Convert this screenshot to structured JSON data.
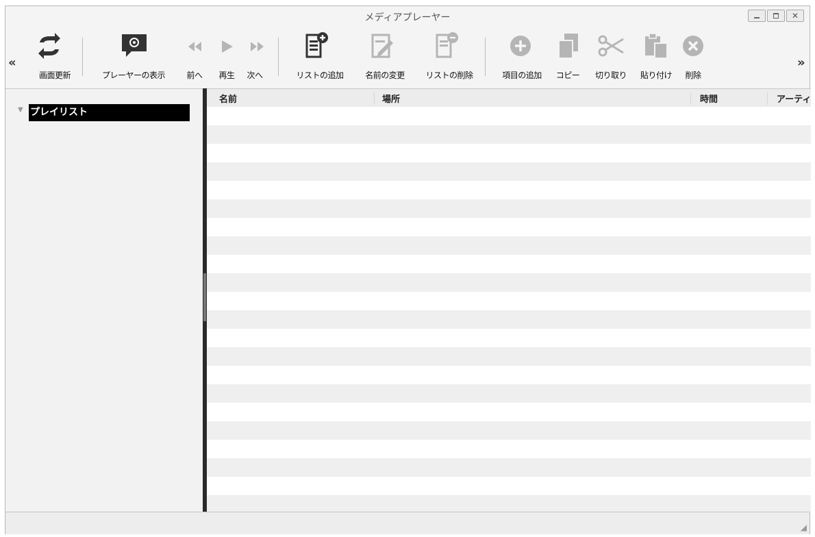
{
  "window": {
    "title": "メディアプレーヤー",
    "controls": {
      "minimize_icon": "minimize-icon",
      "maximize_icon": "maximize-icon",
      "close_glyph": "✕"
    }
  },
  "toolbar": {
    "scroll_left": "«",
    "scroll_right": "»",
    "items": [
      {
        "label": "画面更新",
        "icon": "refresh-icon",
        "enabled": true
      },
      {
        "label": "プレーヤーの表示",
        "icon": "player-display-icon",
        "enabled": true
      },
      {
        "label": "前へ",
        "icon": "previous-icon",
        "enabled": false
      },
      {
        "label": "再生",
        "icon": "play-icon",
        "enabled": false
      },
      {
        "label": "次へ",
        "icon": "next-icon",
        "enabled": false
      },
      {
        "label": "リストの追加",
        "icon": "add-list-icon",
        "enabled": true
      },
      {
        "label": "名前の変更",
        "icon": "rename-icon",
        "enabled": false
      },
      {
        "label": "リストの削除",
        "icon": "delete-list-icon",
        "enabled": false
      },
      {
        "label": "項目の追加",
        "icon": "add-item-icon",
        "enabled": false
      },
      {
        "label": "コピー",
        "icon": "copy-icon",
        "enabled": false
      },
      {
        "label": "切り取り",
        "icon": "cut-icon",
        "enabled": false
      },
      {
        "label": "貼り付け",
        "icon": "paste-icon",
        "enabled": false
      },
      {
        "label": "削除",
        "icon": "delete-icon",
        "enabled": false
      }
    ]
  },
  "sidebar": {
    "tree": [
      {
        "label": "プレイリスト",
        "expanded": true,
        "selected": true
      }
    ]
  },
  "list": {
    "columns": [
      "名前",
      "場所",
      "時間",
      "アーティ"
    ],
    "rows": []
  },
  "colors": {
    "accent_selection": "#000000",
    "row_alt": "#efefef",
    "splitter": "#2a2a2a"
  }
}
